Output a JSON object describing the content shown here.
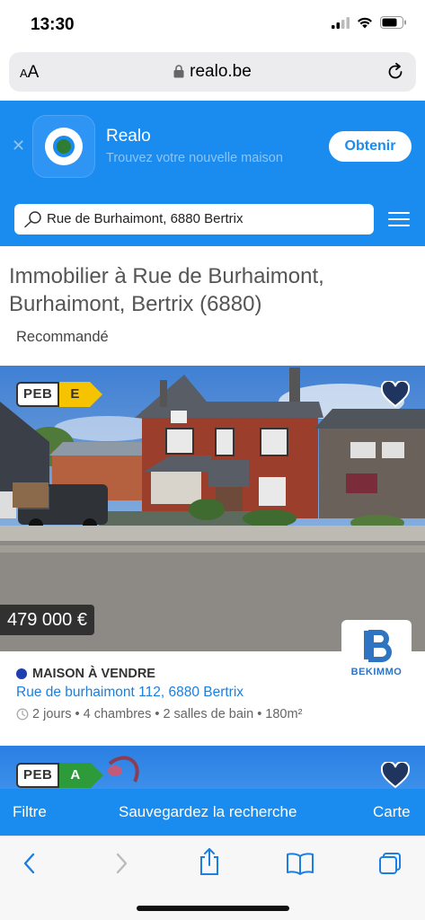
{
  "status_bar": {
    "time": "13:30"
  },
  "browser": {
    "text_size_label_small": "A",
    "text_size_label_large": "A",
    "url": "realo.be"
  },
  "app_banner": {
    "title": "Realo",
    "subtitle": "Trouvez votre nouvelle maison",
    "cta_label": "Obtenir"
  },
  "search": {
    "value": "Rue de Burhaimont, 6880 Bertrix"
  },
  "page": {
    "title": "Immobilier à Rue de Burhaimont, Burhaimont, Bertrix (6880)",
    "sort_label": "Recommandé"
  },
  "listings": [
    {
      "peb_label": "PEB",
      "peb_grade": "E",
      "price": "479 000 €",
      "agency": "BEKIMMO",
      "type": "MAISON À VENDRE",
      "address": "Rue de burhaimont 112, 6880 Bertrix",
      "age": "2 jours",
      "bedrooms": "4 chambres",
      "bathrooms": "2 salles de bain",
      "area": "180m²",
      "type_dot_color": "#1d3fb0"
    },
    {
      "peb_label": "PEB",
      "peb_grade": "A"
    }
  ],
  "action_bar": {
    "filter_label": "Filtre",
    "save_search_label": "Sauvegardez la recherche",
    "map_label": "Carte"
  },
  "colors": {
    "brand_blue": "#1a8cf0",
    "link_blue": "#1a7fe0",
    "peb_e": "#f5c300",
    "peb_a": "#2e9b3a"
  },
  "icons": [
    "lock-icon",
    "reload-icon",
    "close-icon",
    "search-icon",
    "menu-icon",
    "heart-icon",
    "clock-icon",
    "back-icon",
    "forward-icon",
    "share-icon",
    "bookmarks-icon",
    "tabs-icon"
  ]
}
